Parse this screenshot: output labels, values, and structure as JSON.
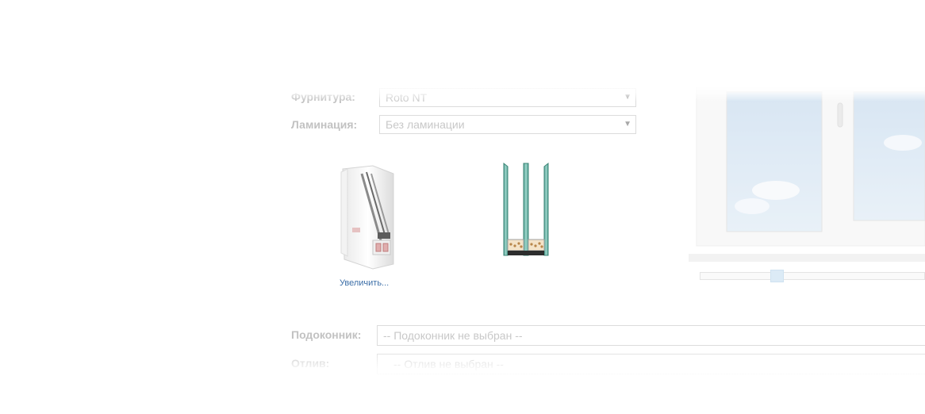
{
  "form": {
    "furnitura": {
      "label": "Фурнитура:",
      "value": "Roto NT"
    },
    "laminacia": {
      "label": "Ламинация:",
      "value": "Без ламинации"
    },
    "podokonnik": {
      "label": "Подоконник:",
      "value": "-- Подоконник не выбран --"
    },
    "otliv": {
      "label": "Отлив:",
      "value": "-- Отлив не выбран --"
    }
  },
  "profile": {
    "zoom_link": "Увеличить..."
  },
  "icons": {
    "profile": "window-profile-cross-section-icon",
    "glass": "triple-glazing-unit-icon",
    "window": "window-preview-image",
    "dropdown": "chevron-down-icon"
  },
  "colors": {
    "label": "#c2c2c2",
    "link": "#3d6fa8",
    "glass": "#6fb8aa",
    "sky": "#d3e3f2"
  }
}
